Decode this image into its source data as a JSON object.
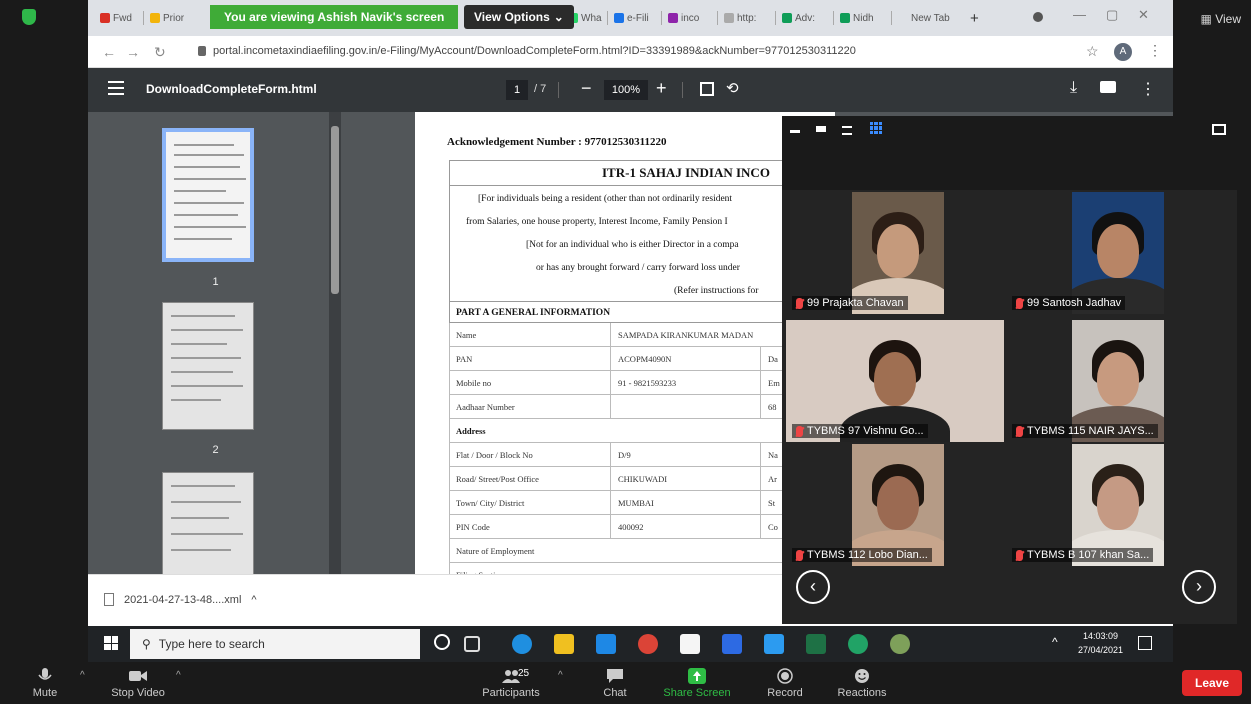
{
  "zoom_top": {
    "view_label": "View"
  },
  "tabs": [
    {
      "label": "Fwd",
      "color": "#d93025"
    },
    {
      "label": "Prior",
      "color": "#f2b40c"
    },
    {
      "label": "Wha",
      "color": "#25d366"
    },
    {
      "label": "e-Fili",
      "color": "#1a73e8"
    },
    {
      "label": "inco",
      "color": "#8e24aa"
    },
    {
      "label": "http:",
      "color": "#aaaaaa"
    },
    {
      "label": "Adv:",
      "color": "#0f9d58"
    },
    {
      "label": "Nidh",
      "color": "#0f9d58"
    },
    {
      "label": "New Tab",
      "color": "#dee1e6"
    }
  ],
  "banner": {
    "text": "You are viewing Ashish Navik's screen",
    "view_options": "View Options"
  },
  "address": {
    "url": "portal.incometaxindiaefiling.gov.in/e-Filing/MyAccount/DownloadCompleteForm.html?ID=33391989&ackNumber=977012530311220",
    "profile_initial": "A"
  },
  "pdf": {
    "filename": "DownloadCompleteForm.html",
    "page_current": "1",
    "page_total": "/ 7",
    "zoom": "100%",
    "thumbnails": [
      {
        "num": "1"
      },
      {
        "num": "2"
      }
    ]
  },
  "doc": {
    "ack_number": "Acknowledgement Number : 977012530311220",
    "title": "ITR-1 SAHAJ INDIAN INCO",
    "intro_lines": [
      "[For individuals being a resident (other than not ordinarily resident",
      "from Salaries, one house property, Interest Income, Family Pension I",
      "[Not for an individual who is either Director in a compa",
      "or has any brought forward / carry forward loss under",
      "(Refer instructions for"
    ],
    "section_head": "PART A GENERAL INFORMATION",
    "rows": [
      {
        "label": "Name",
        "value": "SAMPADA KIRANKUMAR MADAN",
        "extra": ""
      },
      {
        "label": "PAN",
        "value": "ACOPM4090N",
        "extra": "Da"
      },
      {
        "label": "Mobile no",
        "value": "91 - 9821593233",
        "extra": "Em"
      },
      {
        "label": "Aadhaar Number",
        "value": "",
        "extra": "68"
      },
      {
        "label": "Address",
        "value": "",
        "extra": "",
        "bold": true
      },
      {
        "label": "Flat / Door / Block No",
        "value": "D/9",
        "extra": "Na"
      },
      {
        "label": "Road/ Street/Post Office",
        "value": "CHIKUWADI",
        "extra": "Ar"
      },
      {
        "label": "Town/ City/ District",
        "value": "MUMBAI",
        "extra": "St"
      },
      {
        "label": "PIN Code",
        "value": "400092",
        "extra": "Co"
      },
      {
        "label": "Nature of Employment",
        "value": "",
        "extra": ""
      },
      {
        "label": "Filing Section",
        "value": "",
        "extra": ""
      }
    ]
  },
  "download": {
    "filename": "2021-04-27-13-48....xml",
    "caret": "^"
  },
  "taskbar": {
    "search_placeholder": "Type here to search",
    "time": "14:03:09",
    "date": "27/04/2021"
  },
  "participants": [
    {
      "name": "99 Prajakta Chavan",
      "bg": "#6a5a4a",
      "face": "#c59a7c",
      "hair": "#2c1e16",
      "body": "#d9c8b8"
    },
    {
      "name": "99 Santosh Jadhav",
      "bg": "#1b3f73",
      "face": "#b88566",
      "hair": "#111111",
      "body": "#2a2a2a"
    },
    {
      "name": "TYBMS 97 Vishnu Go...",
      "bg": "#d8cbc2",
      "face": "#9f6f52",
      "hair": "#1d140f",
      "body": "#222222"
    },
    {
      "name": "TYBMS 115 NAIR JAYS...",
      "bg": "#c7c2bd",
      "face": "#c79a7f",
      "hair": "#1a1410",
      "body": "#6b5b52"
    },
    {
      "name": "TYBMS 112 Lobo Dian...",
      "bg": "#b59b86",
      "face": "#9b6a52",
      "hair": "#1e1610",
      "body": "#c7a58c"
    },
    {
      "name": "TYBMS B 107 khan Sa...",
      "bg": "#d9d4cd",
      "face": "#c59a84",
      "hair": "#2a2018",
      "body": "#e6e2dc"
    }
  ],
  "controls": {
    "mute": "Mute",
    "stop_video": "Stop Video",
    "participants": "Participants",
    "participant_count": "25",
    "chat": "Chat",
    "share_screen": "Share Screen",
    "record": "Record",
    "reactions": "Reactions",
    "leave": "Leave"
  }
}
